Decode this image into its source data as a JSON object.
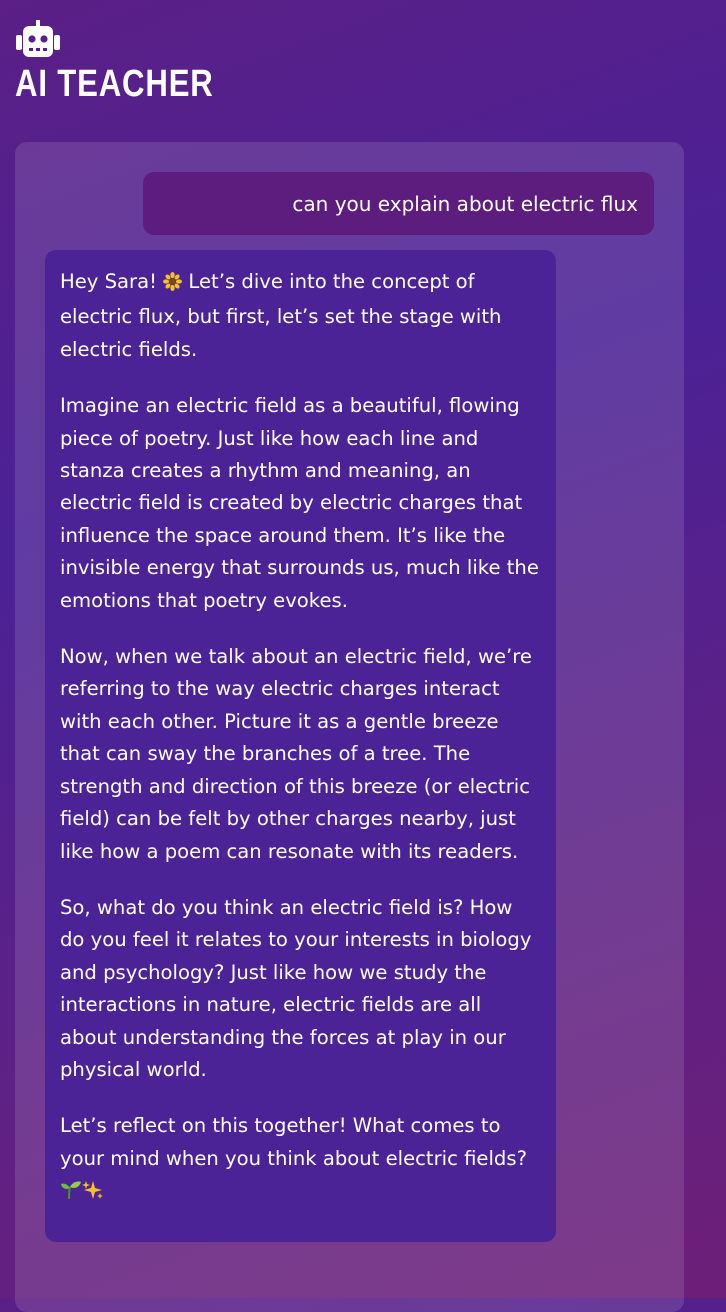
{
  "app": {
    "title": "AI TEACHER",
    "logo_icon": "robot-icon"
  },
  "colors": {
    "background_start": "#5b1f86",
    "background_end": "#6d1f78",
    "user_bubble": "#5c1d7f",
    "ai_bubble": "#4c2397",
    "text": "#ffffff"
  },
  "conversation": {
    "user_message": "can you explain about electric flux",
    "ai_message": {
      "paragraphs": [
        {
          "before_emoji": "Hey Sara! ",
          "emoji": "sunflower-icon",
          "after_emoji": " Let’s dive into the concept of electric flux, but first, let’s set the stage with electric fields."
        },
        {
          "text": "Imagine an electric field as a beautiful, flowing piece of poetry. Just like how each line and stanza creates a rhythm and meaning, an electric field is created by electric charges that influence the space around them. It’s like the invisible energy that surrounds us, much like the emotions that poetry evokes."
        },
        {
          "text": "Now, when we talk about an electric field, we’re referring to the way electric charges interact with each other. Picture it as a gentle breeze that can sway the branches of a tree. The strength and direction of this breeze (or electric field) can be felt by other charges nearby, just like how a poem can resonate with its readers."
        },
        {
          "text": "So, what do you think an electric field is? How do you feel it relates to your interests in biology and psychology? Just like how we study the interactions in nature, electric fields are all about understanding the forces at play in our physical world."
        },
        {
          "text": "Let’s reflect on this together! What comes to your mind when you think about electric fields?",
          "trailing_emojis": [
            "seedling-icon",
            "sparkles-icon"
          ]
        }
      ]
    }
  }
}
